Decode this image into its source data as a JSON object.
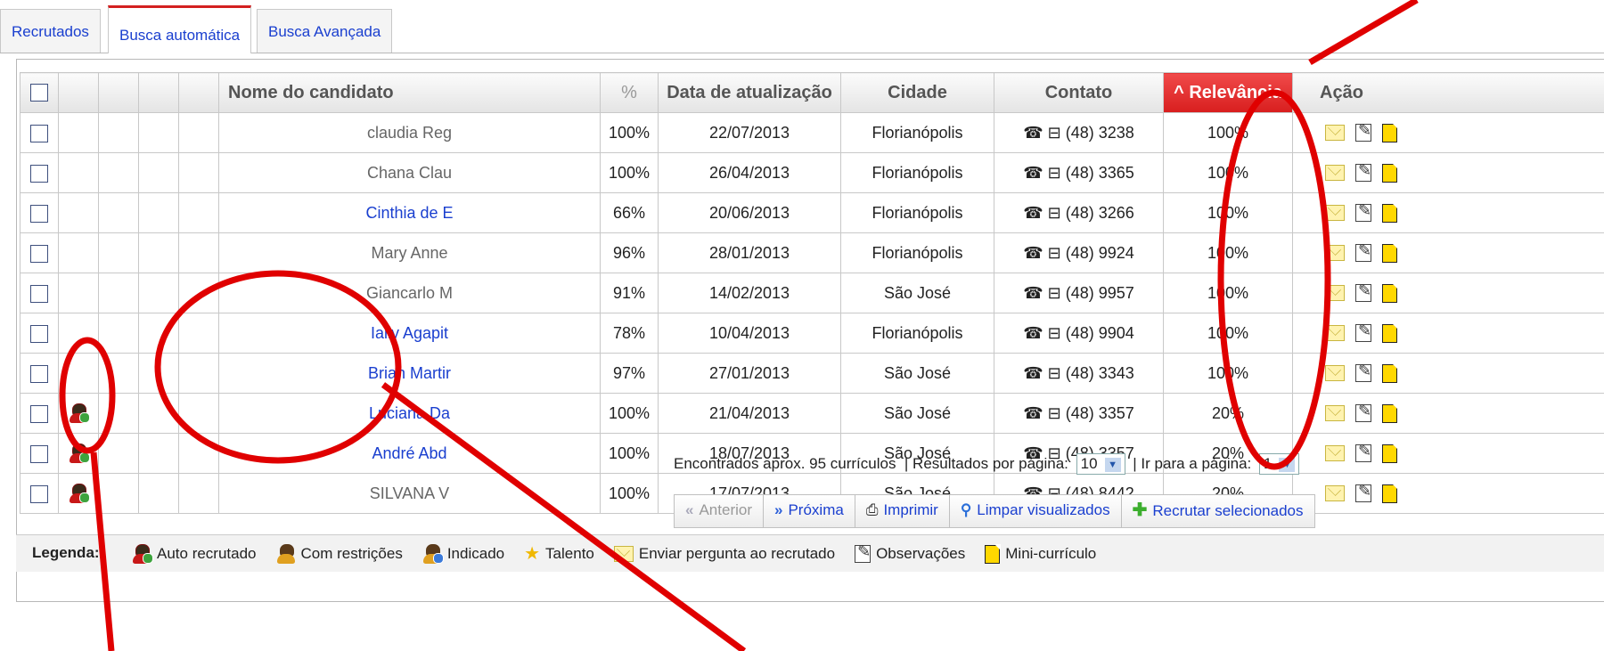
{
  "tabs": [
    {
      "label": "Recrutados"
    },
    {
      "label": "Busca automática"
    },
    {
      "label": "Busca Avançada"
    }
  ],
  "table": {
    "headers": {
      "name": "Nome do candidato",
      "percent": "%",
      "date": "Data de atualização",
      "city": "Cidade",
      "contact": "Contato",
      "relevance": "Relevância",
      "action": "Ação"
    },
    "rows": [
      {
        "name": "claudia Reg",
        "percent": "100%",
        "date": "22/07/2013",
        "city": "Florianópolis",
        "phone": "(48) 3238",
        "relevance": "100%",
        "flag": false,
        "link": false
      },
      {
        "name": "Chana Clau",
        "percent": "100%",
        "date": "26/04/2013",
        "city": "Florianópolis",
        "phone": "(48) 3365",
        "relevance": "100%",
        "flag": false,
        "link": false
      },
      {
        "name": "Cinthia de E",
        "percent": "66%",
        "date": "20/06/2013",
        "city": "Florianópolis",
        "phone": "(48) 3266",
        "relevance": "100%",
        "flag": false,
        "link": true
      },
      {
        "name": "Mary Anne",
        "percent": "96%",
        "date": "28/01/2013",
        "city": "Florianópolis",
        "phone": "(48) 9924",
        "relevance": "100%",
        "flag": false,
        "link": false
      },
      {
        "name": "Giancarlo M",
        "percent": "91%",
        "date": "14/02/2013",
        "city": "São José",
        "phone": "(48) 9957",
        "relevance": "100%",
        "flag": false,
        "link": false
      },
      {
        "name": "Ially Agapit",
        "percent": "78%",
        "date": "10/04/2013",
        "city": "Florianópolis",
        "phone": "(48) 9904",
        "relevance": "100%",
        "flag": false,
        "link": true
      },
      {
        "name": "Brian Martir",
        "percent": "97%",
        "date": "27/01/2013",
        "city": "São José",
        "phone": "(48) 3343",
        "relevance": "100%",
        "flag": false,
        "link": true
      },
      {
        "name": "Luciana Da",
        "percent": "100%",
        "date": "21/04/2013",
        "city": "São José",
        "phone": "(48) 3357",
        "relevance": "20%",
        "flag": true,
        "link": true
      },
      {
        "name": "André Abd",
        "percent": "100%",
        "date": "18/07/2013",
        "city": "São José",
        "phone": "(48) 3357",
        "relevance": "20%",
        "flag": true,
        "link": true
      },
      {
        "name": "SILVANA V",
        "percent": "100%",
        "date": "17/07/2013",
        "city": "São José",
        "phone": "(48) 8442",
        "relevance": "20%",
        "flag": true,
        "link": false
      }
    ]
  },
  "footer": {
    "found": "Encontrados aprox. 95 currículos",
    "per_page_label": "| Resultados por página:",
    "per_page_value": "10",
    "goto_label": "| Ir para a página:",
    "goto_value": "1"
  },
  "toolbar": {
    "prev": "Anterior",
    "next": "Próxima",
    "print": "Imprimir",
    "clear": "Limpar visualizados",
    "recruit": "Recrutar selecionados"
  },
  "legend": {
    "label": "Legenda:",
    "items": [
      "Auto recrutado",
      "Com restrições",
      "Indicado",
      "Talento",
      "Enviar pergunta ao recrutado",
      "Observações",
      "Mini-currículo"
    ]
  },
  "colors": {
    "accent": "#d81e1e",
    "link": "#1a3fcf",
    "annotation": "#e00000"
  }
}
